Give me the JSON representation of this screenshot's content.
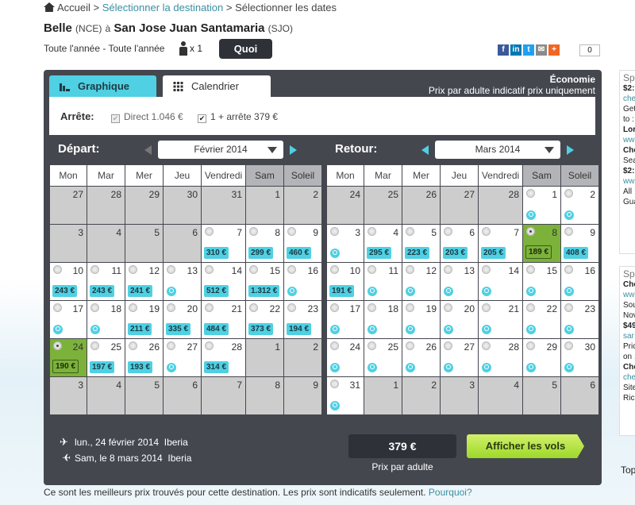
{
  "breadcrumb": {
    "home": "Accueil",
    "destination": "Sélectionner la destination",
    "current": "Sélectionner les dates",
    "sep": ">"
  },
  "route": {
    "from": "Belle",
    "from_code": "(NCE)",
    "to_word": "à",
    "to": "San Jose Juan Santamaria",
    "to_code": "(SJO)"
  },
  "trip_summary": {
    "dates": "Toute l'année - Toute l'année",
    "passengers": "x 1",
    "button": "Quoi"
  },
  "share": {
    "count": "0",
    "icons": [
      "facebook-icon",
      "linkedin-icon",
      "twitter-icon",
      "email-icon",
      "plus-icon"
    ],
    "colors": [
      "#3b5998",
      "#0077b5",
      "#1da1f2",
      "#8a8a8a",
      "#f26522"
    ]
  },
  "tabs": [
    {
      "label": "Graphique",
      "icon": "bar-chart-icon"
    },
    {
      "label": "Calendrier",
      "icon": "grid-icon",
      "active": true
    }
  ],
  "cabin": {
    "title": "Économie",
    "note": "Prix par adulte indicatif prix uniquement"
  },
  "filter": {
    "label": "Arrête:",
    "direct": "Direct 1.046 €",
    "one_stop": "1 + arrête 379 €",
    "direct_checked": true,
    "one_stop_checked": true
  },
  "colors": {
    "accent": "#4fd0e3",
    "selected": "#7cb23a",
    "panel": "#45474f",
    "cta": "#b5e445"
  },
  "weekdays": [
    "Mon",
    "Mar",
    "Mer",
    "Jeu",
    "Vendredi",
    "Sam",
    "Soleil"
  ],
  "departure": {
    "label": "Départ:",
    "month": "Février 2014",
    "rows": [
      [
        {
          "d": "27",
          "off": true
        },
        {
          "d": "28",
          "off": true
        },
        {
          "d": "29",
          "off": true
        },
        {
          "d": "30",
          "off": true
        },
        {
          "d": "31",
          "off": true
        },
        {
          "d": "1",
          "off": true
        },
        {
          "d": "2",
          "off": true
        }
      ],
      [
        {
          "d": "3",
          "off": true
        },
        {
          "d": "4",
          "off": true
        },
        {
          "d": "5",
          "off": true
        },
        {
          "d": "6",
          "off": true
        },
        {
          "d": "7",
          "p": "310 €"
        },
        {
          "d": "8",
          "p": "299 €"
        },
        {
          "d": "9",
          "p": "460 €"
        }
      ],
      [
        {
          "d": "10",
          "p": "243 €"
        },
        {
          "d": "11",
          "p": "243 €"
        },
        {
          "d": "12",
          "p": "241 €"
        },
        {
          "d": "13"
        },
        {
          "d": "14",
          "p": "512 €"
        },
        {
          "d": "15",
          "p": "1.312 €"
        },
        {
          "d": "16"
        }
      ],
      [
        {
          "d": "17"
        },
        {
          "d": "18"
        },
        {
          "d": "19",
          "p": "211 €"
        },
        {
          "d": "20",
          "p": "335 €"
        },
        {
          "d": "21",
          "p": "484 €"
        },
        {
          "d": "22",
          "p": "373 €"
        },
        {
          "d": "23",
          "p": "194 €"
        }
      ],
      [
        {
          "d": "24",
          "p": "190 €",
          "sel": true
        },
        {
          "d": "25",
          "p": "197 €"
        },
        {
          "d": "26",
          "p": "193 €"
        },
        {
          "d": "27"
        },
        {
          "d": "28",
          "p": "314 €"
        },
        {
          "d": "1",
          "off": true
        },
        {
          "d": "2",
          "off": true
        }
      ],
      [
        {
          "d": "3",
          "off": true
        },
        {
          "d": "4",
          "off": true
        },
        {
          "d": "5",
          "off": true
        },
        {
          "d": "6",
          "off": true
        },
        {
          "d": "7",
          "off": true
        },
        {
          "d": "8",
          "off": true
        },
        {
          "d": "9",
          "off": true
        }
      ]
    ]
  },
  "return": {
    "label": "Retour:",
    "month": "Mars 2014",
    "rows": [
      [
        {
          "d": "24",
          "off": true
        },
        {
          "d": "25",
          "off": true
        },
        {
          "d": "26",
          "off": true
        },
        {
          "d": "27",
          "off": true
        },
        {
          "d": "28",
          "off": true
        },
        {
          "d": "1"
        },
        {
          "d": "2"
        }
      ],
      [
        {
          "d": "3"
        },
        {
          "d": "4",
          "p": "295 €"
        },
        {
          "d": "5",
          "p": "223 €"
        },
        {
          "d": "6",
          "p": "203 €"
        },
        {
          "d": "7",
          "p": "205 €"
        },
        {
          "d": "8",
          "p": "189 €",
          "sel": true
        },
        {
          "d": "9",
          "p": "408 €"
        }
      ],
      [
        {
          "d": "10",
          "p": "191 €"
        },
        {
          "d": "11"
        },
        {
          "d": "12"
        },
        {
          "d": "13"
        },
        {
          "d": "14"
        },
        {
          "d": "15"
        },
        {
          "d": "16"
        }
      ],
      [
        {
          "d": "17"
        },
        {
          "d": "18"
        },
        {
          "d": "19"
        },
        {
          "d": "20"
        },
        {
          "d": "21"
        },
        {
          "d": "22"
        },
        {
          "d": "23"
        }
      ],
      [
        {
          "d": "24"
        },
        {
          "d": "25"
        },
        {
          "d": "26"
        },
        {
          "d": "27"
        },
        {
          "d": "28"
        },
        {
          "d": "29"
        },
        {
          "d": "30"
        }
      ],
      [
        {
          "d": "31"
        },
        {
          "d": "1",
          "off": true
        },
        {
          "d": "2",
          "off": true
        },
        {
          "d": "3",
          "off": true
        },
        {
          "d": "4",
          "off": true
        },
        {
          "d": "5",
          "off": true
        },
        {
          "d": "6",
          "off": true
        }
      ]
    ]
  },
  "selection": {
    "outbound": {
      "date": "lun., 24 février 2014",
      "airline": "Iberia"
    },
    "inbound": {
      "date": "Sam, le 8 mars 2014",
      "airline": "Iberia"
    },
    "price": "379 €",
    "price_label": "Prix par adulte",
    "button": "Afficher les vols"
  },
  "footer": {
    "note": "Ce sont les meilleurs prix trouvés pour cette destination. Les prix sont indicatifs seulement.",
    "link": "Pourquoi?"
  },
  "sidebar": {
    "ad1": [
      "Sp",
      "$2:",
      "che",
      "Get",
      "to :",
      "Lor",
      "ww",
      "Che",
      "Sea",
      "$2:",
      "ww",
      "All",
      "Gua"
    ],
    "ad2": [
      "Sp",
      "Che",
      "ww",
      "Sou",
      "Nov",
      "$49",
      "sar",
      "Pric",
      "on .",
      "Che",
      "che",
      "Site",
      "Ric"
    ],
    "top": "Top"
  }
}
